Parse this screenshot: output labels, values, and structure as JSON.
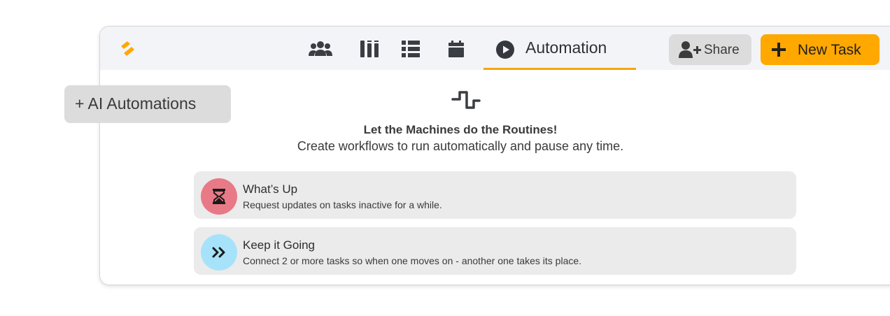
{
  "header": {
    "tabs": [
      {
        "icon": "team-icon"
      },
      {
        "icon": "board-columns-icon"
      },
      {
        "icon": "list-icon"
      },
      {
        "icon": "calendar-icon"
      }
    ],
    "active_tab": {
      "icon": "play-circle-icon",
      "label": "Automation"
    },
    "share_label": "Share",
    "new_task_label": "New Task"
  },
  "ai_button": {
    "label": "+ AI Automations"
  },
  "main": {
    "headline": "Let the Machines do the Routines!",
    "subline": "Create workflows to run automatically and pause any time.",
    "cards": [
      {
        "title": "What’s Up",
        "description": "Request updates on tasks inactive for a while.",
        "icon": "hourglass-icon",
        "color": "#e87986"
      },
      {
        "title": "Keep it Going",
        "description": "Connect 2 or more tasks so when one moves on - another one takes its place.",
        "icon": "double-chevron-right-icon",
        "color": "#a6e3fb"
      }
    ]
  },
  "colors": {
    "accent": "#ffa800",
    "tab_underline": "#f6a700",
    "topbar_bg": "#f3f4f7",
    "button_gray": "#dcdcdc",
    "card_bg": "#ebebeb"
  }
}
